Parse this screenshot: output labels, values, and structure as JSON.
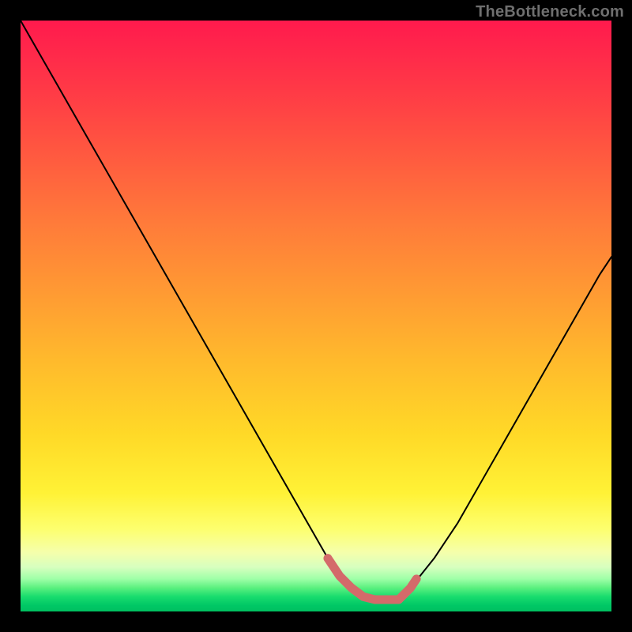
{
  "watermark": "TheBottleneck.com",
  "chart_data": {
    "type": "line",
    "title": "",
    "xlabel": "",
    "ylabel": "",
    "xlim": [
      0,
      100
    ],
    "ylim": [
      0,
      100
    ],
    "grid": false,
    "legend": false,
    "series": [
      {
        "name": "bottleneck-curve",
        "color": "#000000",
        "stroke_width": 2,
        "x": [
          0,
          4,
          8,
          12,
          16,
          20,
          24,
          28,
          32,
          36,
          40,
          44,
          48,
          52,
          54,
          56,
          58,
          60,
          62,
          64,
          66,
          70,
          74,
          78,
          82,
          86,
          90,
          94,
          98,
          100
        ],
        "y": [
          100,
          93,
          86,
          79,
          72,
          65,
          58,
          51,
          44,
          37,
          30,
          23,
          16,
          9,
          6,
          4,
          2.5,
          2,
          2,
          2,
          4,
          9,
          15,
          22,
          29,
          36,
          43,
          50,
          57,
          60
        ]
      },
      {
        "name": "optimal-highlight",
        "color": "#d46a6a",
        "stroke_width": 11,
        "x": [
          52,
          54,
          56,
          58,
          60,
          62,
          64,
          66,
          67
        ],
        "y": [
          9,
          6,
          4,
          2.5,
          2,
          2,
          2,
          4,
          5.5
        ]
      }
    ]
  }
}
